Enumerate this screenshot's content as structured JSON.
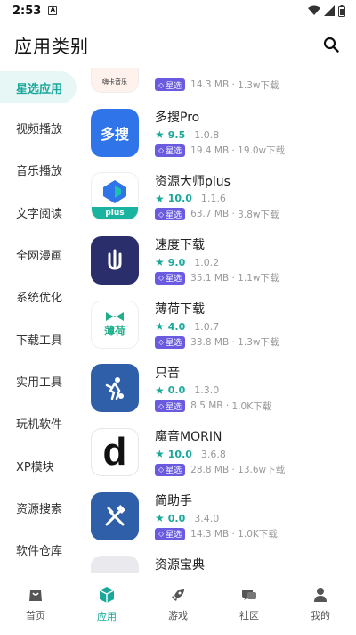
{
  "status": {
    "time": "2:53",
    "notif": "A"
  },
  "header": {
    "title": "应用类别"
  },
  "sidebar": {
    "items": [
      {
        "label": "星选应用",
        "active": true
      },
      {
        "label": "视频播放"
      },
      {
        "label": "音乐播放"
      },
      {
        "label": "文字阅读"
      },
      {
        "label": "全网漫画"
      },
      {
        "label": "系统优化"
      },
      {
        "label": "下载工具"
      },
      {
        "label": "实用工具"
      },
      {
        "label": "玩机软件"
      },
      {
        "label": "XP模块"
      },
      {
        "label": "资源搜索"
      },
      {
        "label": "软件仓库"
      }
    ]
  },
  "apps": [
    {
      "name": "",
      "score": "",
      "version": "",
      "badge": "星选",
      "size": "14.3 MB",
      "downloads": "1.3w下载",
      "icon_text": "嗨卡音乐",
      "icon_bg": "#fff2ec"
    },
    {
      "name": "多搜Pro",
      "score": "9.5",
      "version": "1.0.8",
      "badge": "星选",
      "size": "19.4 MB",
      "downloads": "19.0w下载",
      "icon_text": "多搜",
      "icon_bg": "#2f74e8"
    },
    {
      "name": "资源大师plus",
      "score": "10.0",
      "version": "1.1.6",
      "badge": "星选",
      "size": "63.7 MB",
      "downloads": "3.8w下载",
      "icon_text": "plus",
      "icon_bg": "#ffffff"
    },
    {
      "name": "速度下载",
      "score": "9.0",
      "version": "1.0.2",
      "badge": "星选",
      "size": "35.1 MB",
      "downloads": "1.1w下载",
      "icon_text": "",
      "icon_bg": "#2a2f6b"
    },
    {
      "name": "薄荷下载",
      "score": "4.0",
      "version": "1.0.7",
      "badge": "星选",
      "size": "33.8 MB",
      "downloads": "1.3w下载",
      "icon_text": "薄荷",
      "icon_bg": "#ffffff"
    },
    {
      "name": "只音",
      "score": "0.0",
      "version": "1.3.0",
      "badge": "星选",
      "size": "8.5 MB",
      "downloads": "1.0K下载",
      "icon_text": "",
      "icon_bg": "#2e5fa8"
    },
    {
      "name": "魔音MORIN",
      "score": "10.0",
      "version": "3.6.8",
      "badge": "星选",
      "size": "28.8 MB",
      "downloads": "13.6w下载",
      "icon_text": "d",
      "icon_bg": "#ffffff"
    },
    {
      "name": "简助手",
      "score": "0.0",
      "version": "3.4.0",
      "badge": "星选",
      "size": "14.3 MB",
      "downloads": "1.0K下载",
      "icon_text": "",
      "icon_bg": "#2e5fa8"
    },
    {
      "name": "资源宝典",
      "score": "",
      "version": "",
      "badge": "",
      "size": "",
      "downloads": "",
      "icon_text": "",
      "icon_bg": "#e9e9ee"
    }
  ],
  "nav": [
    {
      "label": "首页",
      "icon": "bag-icon"
    },
    {
      "label": "应用",
      "icon": "cube-icon",
      "active": true
    },
    {
      "label": "游戏",
      "icon": "rocket-icon"
    },
    {
      "label": "社区",
      "icon": "chat-icon"
    },
    {
      "label": "我的",
      "icon": "person-icon"
    }
  ],
  "colors": {
    "accent": "#1aa89a",
    "badge": "#6a5ae0"
  }
}
